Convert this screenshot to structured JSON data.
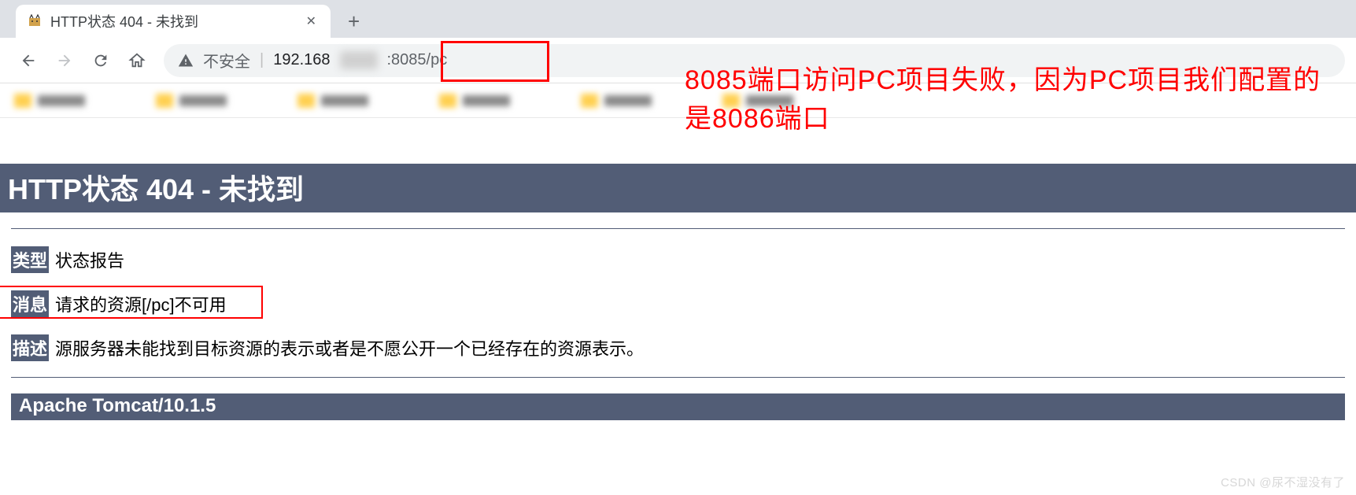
{
  "tab": {
    "title": "HTTP状态 404 - 未找到"
  },
  "toolbar": {
    "security_text": "不安全",
    "url_host": "192.168",
    "url_path_port": ":8085/pc"
  },
  "annotation": {
    "text": "8085端口访问PC项目失败，因为PC项目我们配置的是8086端口"
  },
  "error": {
    "heading": "HTTP状态 404 - 未找到",
    "type_label": "类型",
    "type_value": "状态报告",
    "message_label": "消息",
    "message_value": "请求的资源[/pc]不可用",
    "description_label": "描述",
    "description_value": "源服务器未能找到目标资源的表示或者是不愿公开一个已经存在的资源表示。",
    "footer": "Apache Tomcat/10.1.5"
  },
  "watermark": "CSDN @尿不湿没有了"
}
